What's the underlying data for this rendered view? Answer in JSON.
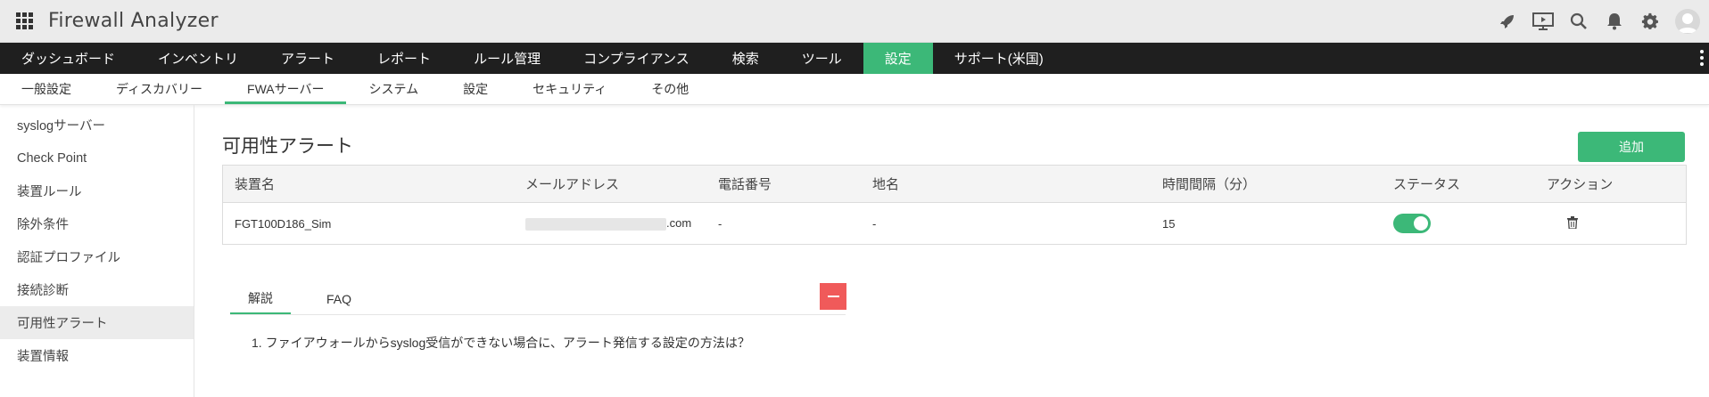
{
  "app": {
    "title": "Firewall Analyzer"
  },
  "header_icons": [
    "rocket-icon",
    "presentation-icon",
    "search-icon",
    "bell-icon",
    "gear-icon",
    "user-avatar-icon"
  ],
  "nav": {
    "items": [
      "ダッシュボード",
      "インベントリ",
      "アラート",
      "レポート",
      "ルール管理",
      "コンプライアンス",
      "検索",
      "ツール",
      "設定",
      "サポート(米国)"
    ],
    "active": "設定"
  },
  "subnav": {
    "items": [
      "一般設定",
      "ディスカバリー",
      "FWAサーバー",
      "システム",
      "設定",
      "セキュリティ",
      "その他"
    ],
    "active": "FWAサーバー"
  },
  "sidebar": {
    "items": [
      "syslogサーバー",
      "Check Point",
      "装置ルール",
      "除外条件",
      "認証プロファイル",
      "接続診断",
      "可用性アラート",
      "装置情報"
    ],
    "active": "可用性アラート"
  },
  "main": {
    "title": "可用性アラート",
    "add_label": "追加",
    "table": {
      "headers": [
        "装置名",
        "メールアドレス",
        "電話番号",
        "地名",
        "時間間隔（分）",
        "ステータス",
        "アクション"
      ],
      "rows": [
        {
          "device": "FGT100D186_Sim",
          "email_suffix": ".com",
          "phone": "-",
          "place": "-",
          "interval": "15",
          "status_on": true
        }
      ]
    },
    "tabs": [
      "解説",
      "FAQ"
    ],
    "active_tab": "解説",
    "faq_item": "1. ファイアウォールからsyslog受信ができない場合に、アラート発信する設定の方法は？"
  },
  "colors": {
    "accent": "#3cb878",
    "nav_bg": "#1f1f1f",
    "danger": "#f05a5a"
  }
}
